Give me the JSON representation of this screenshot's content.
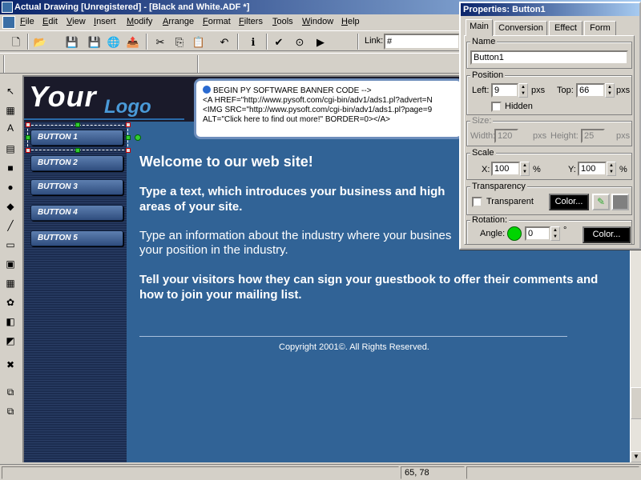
{
  "window": {
    "title": "Actual Drawing [Unregistered] - [Black and White.ADF *]"
  },
  "menu": {
    "items": [
      "File",
      "Edit",
      "View",
      "Insert",
      "Modify",
      "Arrange",
      "Format",
      "Filters",
      "Tools",
      "Window",
      "Help"
    ]
  },
  "toolbar": {
    "link_label": "Link:",
    "link_value": "#"
  },
  "canvas": {
    "logo_your": "Your",
    "logo_logo": "Logo",
    "nav_buttons": [
      "BUTTON 1",
      "BUTTON 2",
      "BUTTON 3",
      "BUTTON 4",
      "BUTTON 5"
    ],
    "banner_lines": [
      "BEGIN PY SOFTWARE BANNER CODE -->",
      "<A HREF=\"http://www.pysoft.com/cgi-bin/adv1/ads1.pl?advert=N",
      "<IMG SRC=\"http://www.pysoft.com/cgi-bin/adv1/ads1.pl?page=9",
      "ALT=\"Click here to find out more!\" BORDER=0></A>"
    ],
    "heading": "Welcome to our web site!",
    "para1_line1": "Type a text, which introduces your business and high",
    "para1_line2": "areas of your site.",
    "para2_line1": "Type an information about the industry where your busines",
    "para2_line2": "your position in the industry.",
    "para3": "Tell your visitors how they can sign your guestbook to offer their comments and how to join your mailing list.",
    "copyright": "Copyright 2001©. All Rights Reserved."
  },
  "status": {
    "coords": "65, 78"
  },
  "properties": {
    "title": "Properties: Button1",
    "tabs": [
      "Main",
      "Conversion",
      "Effect",
      "Form"
    ],
    "name_group": "Name",
    "name_value": "Button1",
    "position_group": "Position",
    "left_label": "Left:",
    "left_value": "9",
    "left_unit": "pxs",
    "top_label": "Top:",
    "top_value": "66",
    "top_unit": "pxs",
    "hidden_label": "Hidden",
    "size_group": "Size:",
    "width_label": "Width:",
    "width_value": "120",
    "width_unit": "pxs",
    "height_label": "Height:",
    "height_value": "25",
    "height_unit": "pxs",
    "scale_group": "Scale",
    "x_label": "X:",
    "x_value": "100",
    "y_label": "Y:",
    "y_value": "100",
    "pct": "%",
    "transparency_group": "Transparency",
    "transparent_label": "Transparent",
    "color_button": "Color...",
    "rotation_group": "Rotation:",
    "angle_label": "Angle:",
    "angle_value": "0",
    "degree": "°",
    "rotation_color_button": "Color..."
  }
}
